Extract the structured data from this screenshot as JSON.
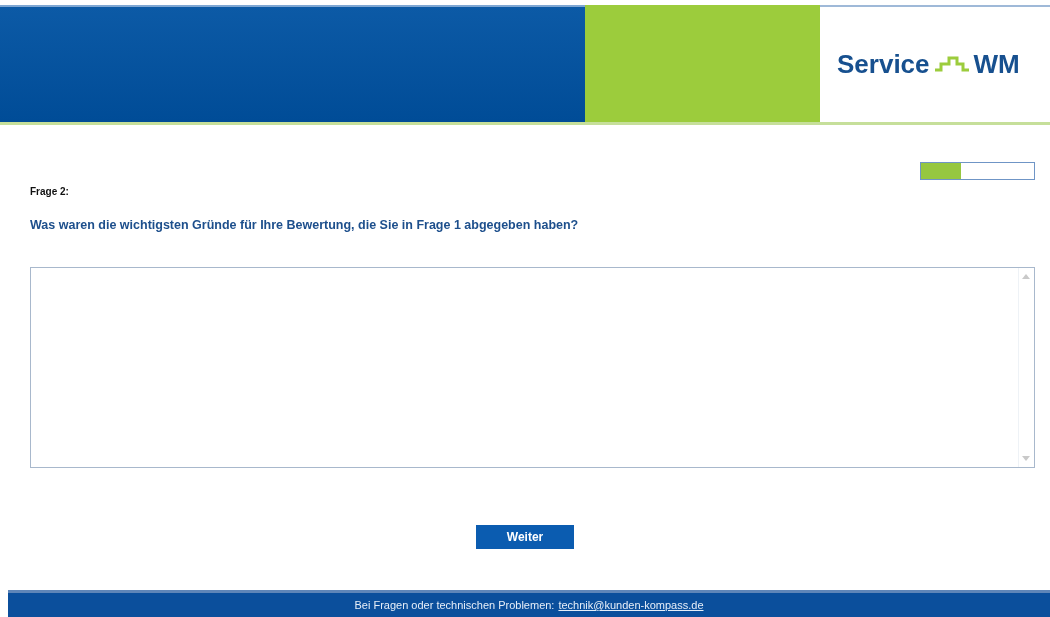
{
  "header": {
    "logo": {
      "word_1": "Service",
      "word_2": "WM"
    }
  },
  "progress": {
    "level": 0.35
  },
  "question": {
    "number": "Frage 2:",
    "text": "Was waren die wichtigsten Gründe für Ihre Bewertung, die Sie in Frage 1 abgegeben haben?"
  },
  "button": {
    "label": "Weiter"
  },
  "footer": {
    "text": "Bei Fragen oder technischen Problemen:",
    "link": "technik@kunden-kompass.de"
  }
}
